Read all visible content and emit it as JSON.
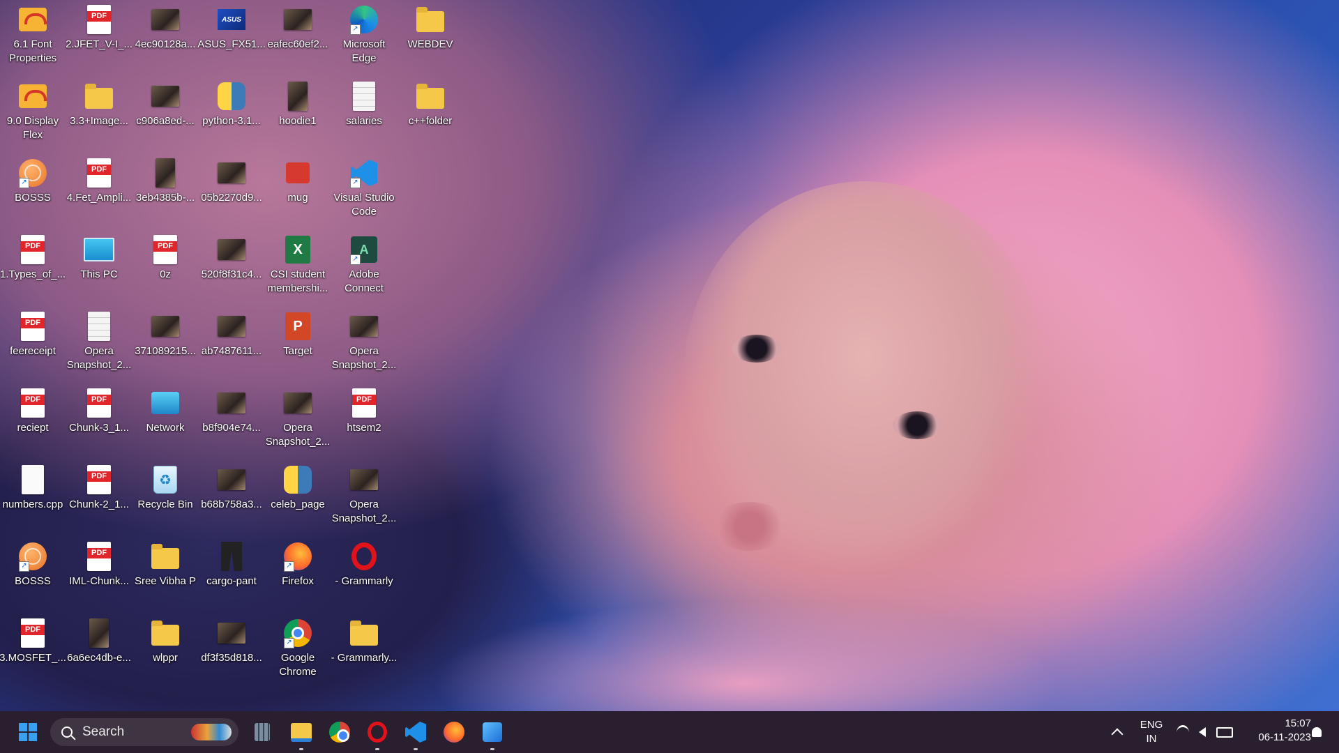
{
  "desktop": {
    "icons": [
      {
        "label": "6.1 Font Properties",
        "type": "fontprop"
      },
      {
        "label": "2.JFET_V-I_...",
        "type": "pdf"
      },
      {
        "label": "4ec90128a...",
        "type": "image"
      },
      {
        "label": "ASUS_FX51...",
        "type": "asus"
      },
      {
        "label": "eafec60ef2...",
        "type": "image"
      },
      {
        "label": "Microsoft Edge",
        "type": "edge"
      },
      {
        "label": "WEBDEV",
        "type": "folder"
      },
      {
        "label": "9.0 Display Flex",
        "type": "fontprop"
      },
      {
        "label": "3.3+Image...",
        "type": "folder"
      },
      {
        "label": "c906a8ed-...",
        "type": "image"
      },
      {
        "label": "python-3.1...",
        "type": "python"
      },
      {
        "label": "hoodie1",
        "type": "image-tall"
      },
      {
        "label": "salaries",
        "type": "doc"
      },
      {
        "label": "c++folder",
        "type": "folder"
      },
      {
        "label": "BOSSS",
        "type": "globe"
      },
      {
        "label": "4.Fet_Ampli...",
        "type": "pdf"
      },
      {
        "label": "3eb4385b-...",
        "type": "image-tall"
      },
      {
        "label": "05b2270d9...",
        "type": "image"
      },
      {
        "label": "mug",
        "type": "mug"
      },
      {
        "label": "Visual Studio Code",
        "type": "vscode"
      },
      {
        "label": "1.Types_of_...",
        "type": "pdf"
      },
      {
        "label": "This PC",
        "type": "monitor"
      },
      {
        "label": "0z",
        "type": "pdf"
      },
      {
        "label": "520f8f31c4...",
        "type": "image"
      },
      {
        "label": "CSI student membershi...",
        "type": "excel"
      },
      {
        "label": "Adobe Connect",
        "type": "adobe"
      },
      {
        "label": "feereceipt",
        "type": "pdf"
      },
      {
        "label": "Opera Snapshot_2...",
        "type": "doc"
      },
      {
        "label": "371089215...",
        "type": "image"
      },
      {
        "label": "ab7487611...",
        "type": "image"
      },
      {
        "label": "Target",
        "type": "ppt"
      },
      {
        "label": "Opera Snapshot_2...",
        "type": "image"
      },
      {
        "label": "reciept",
        "type": "pdf"
      },
      {
        "label": "Chunk-3_1...",
        "type": "pdf"
      },
      {
        "label": "Network",
        "type": "network"
      },
      {
        "label": "b8f904e74...",
        "type": "image"
      },
      {
        "label": "Opera Snapshot_2...",
        "type": "image"
      },
      {
        "label": "htsem2",
        "type": "pdf"
      },
      {
        "label": "numbers.cpp",
        "type": "blank"
      },
      {
        "label": "Chunk-2_1...",
        "type": "pdf"
      },
      {
        "label": "Recycle Bin",
        "type": "recycle"
      },
      {
        "label": "b68b758a3...",
        "type": "image"
      },
      {
        "label": "celeb_page",
        "type": "python"
      },
      {
        "label": "Opera Snapshot_2...",
        "type": "image"
      },
      {
        "label": "BOSSS",
        "type": "globe"
      },
      {
        "label": "IML-Chunk...",
        "type": "pdf"
      },
      {
        "label": "Sree Vibha P",
        "type": "folder"
      },
      {
        "label": "cargo-pant",
        "type": "cargo"
      },
      {
        "label": "Firefox",
        "type": "firefox"
      },
      {
        "label": "- Grammarly",
        "type": "opera"
      },
      {
        "label": "3.MOSFET_...",
        "type": "pdf"
      },
      {
        "label": "6a6ec4db-e...",
        "type": "image-tall"
      },
      {
        "label": "wlppr",
        "type": "folder"
      },
      {
        "label": "df3f35d818...",
        "type": "image"
      },
      {
        "label": "Google Chrome",
        "type": "chrome"
      },
      {
        "label": "- Grammarly...",
        "type": "folder"
      }
    ]
  },
  "taskbar": {
    "search_label": "Search",
    "pinned": [
      "windows-start-icon",
      "widgets-icon",
      "file-explorer-icon",
      "chrome-icon",
      "opera-icon",
      "vscode-icon",
      "firefox-icon",
      "photos-icon"
    ],
    "language_line1": "ENG",
    "language_line2": "IN",
    "time": "15:07",
    "date": "06-11-2023"
  },
  "colors": {
    "taskbar_bg": "#2a1f2e",
    "accent": "#1e90e8"
  }
}
